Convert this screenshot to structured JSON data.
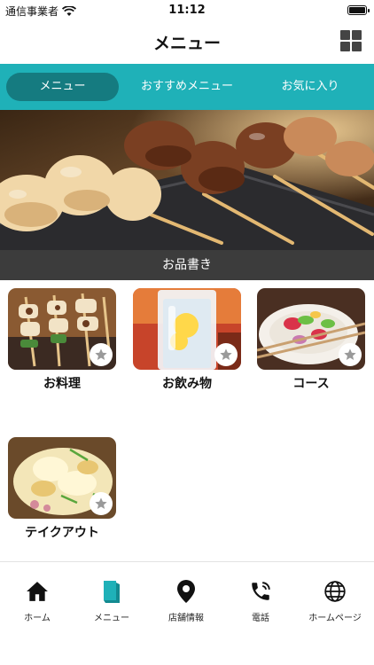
{
  "status": {
    "carrier": "通信事業者",
    "time": "11:12"
  },
  "nav": {
    "title": "メニュー"
  },
  "tabs": [
    {
      "label": "メニュー",
      "active": true
    },
    {
      "label": "おすすめメニュー",
      "active": false
    },
    {
      "label": "お気に入り",
      "active": false
    }
  ],
  "section": {
    "title": "お品書き"
  },
  "categories": [
    {
      "label": "お料理"
    },
    {
      "label": "お飲み物"
    },
    {
      "label": "コース"
    },
    {
      "label": "テイクアウト"
    }
  ],
  "bottom_tabs": [
    {
      "label": "ホーム",
      "icon": "home-icon"
    },
    {
      "label": "メニュー",
      "icon": "book-icon",
      "active": true
    },
    {
      "label": "店舗情報",
      "icon": "location-pin-icon"
    },
    {
      "label": "電話",
      "icon": "phone-icon"
    },
    {
      "label": "ホームページ",
      "icon": "globe-icon"
    }
  ],
  "colors": {
    "accent": "#1fb1b8",
    "accent_dark": "#157b80",
    "section_bar": "#3c3c3c"
  }
}
